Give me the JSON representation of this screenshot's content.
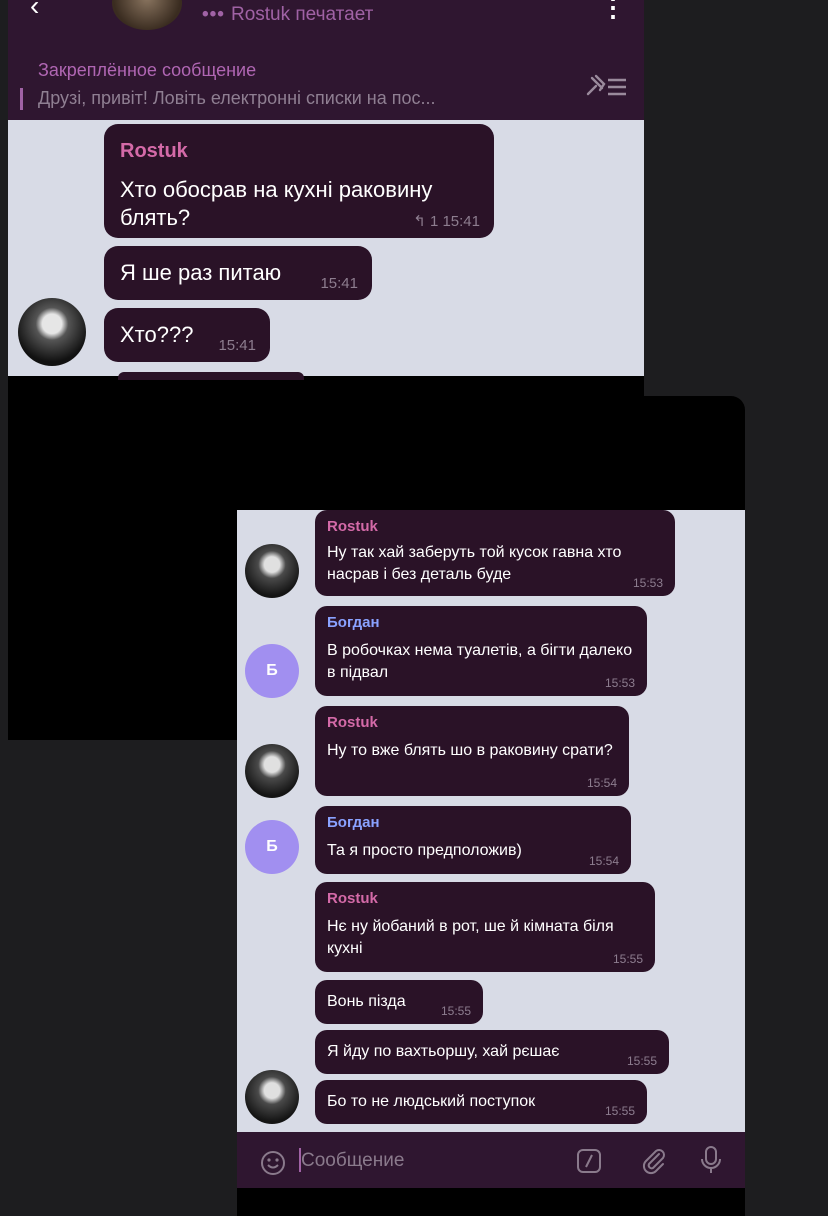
{
  "top_header": {
    "status_dots": "•••",
    "status_text": "Rostuk печатает",
    "pinned_title": "Закреплённое сообщение",
    "pinned_text": "Друзі, привіт!  Ловіть електронні списки на пос..."
  },
  "top_messages": [
    {
      "sender": "Rostuk",
      "text": "Хто обосрав на кухні раковину блять?",
      "replies": "1",
      "time": "15:41"
    },
    {
      "text": "Я ше раз питаю",
      "time": "15:41"
    },
    {
      "text": "Хто???",
      "time": "15:41"
    }
  ],
  "right_messages": [
    {
      "sender": "Rostuk",
      "text": "Ну так хай заберуть той кусок гавна хто насрав і без деталь буде",
      "time": "15:53"
    },
    {
      "sender": "Богдан",
      "text": "В робочках нема туалетів, а бігти далеко в підвал",
      "time": "15:53"
    },
    {
      "sender": "Rostuk",
      "text": "Ну то вже блять шо в раковину срати?",
      "time": "15:54"
    },
    {
      "sender": "Богдан",
      "text": "Та я просто предположив)",
      "time": "15:54"
    },
    {
      "sender": "Rostuk",
      "text": "Нє ну йобаний в рот, ше й кімната біля кухні",
      "time": "15:55"
    },
    {
      "text": "Вонь пізда",
      "time": "15:55"
    },
    {
      "text": "Я йду по вахтьоршу, хай рєшає",
      "time": "15:55"
    },
    {
      "text": "Бо то не людський поступок",
      "time": "15:55"
    }
  ],
  "avatar_letter": "Б",
  "input": {
    "placeholder": "Сообщение"
  },
  "colors": {
    "bubble": "#2a1227",
    "chat_bg": "#d8dbe6",
    "header": "#2f1630",
    "sender_rostuk": "#d46aa8",
    "sender_bohdan": "#8aa2ff",
    "avatar_letter_bg": "#a18ff0"
  },
  "icons": [
    "back-arrow-icon",
    "more-vert-icon",
    "pin-list-icon",
    "reply-icon",
    "emoji-icon",
    "bot-command-icon",
    "attach-icon",
    "mic-icon"
  ]
}
